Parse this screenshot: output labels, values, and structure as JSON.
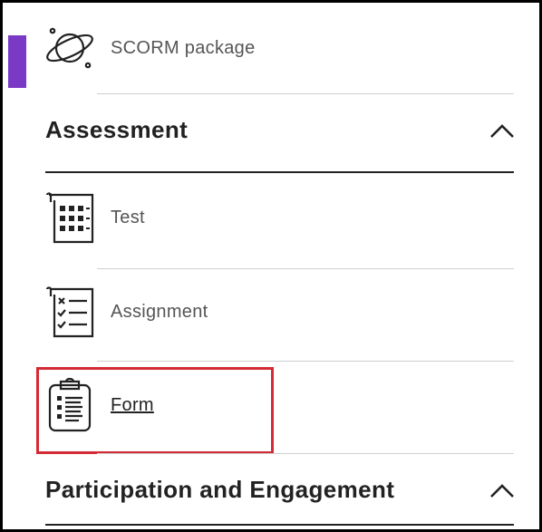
{
  "items": {
    "scorm": {
      "label": "SCORM package",
      "icon": "planet-icon"
    },
    "test": {
      "label": "Test",
      "icon": "test-grid-icon"
    },
    "assignment": {
      "label": "Assignment",
      "icon": "assignment-checklist-icon"
    },
    "form": {
      "label": "Form",
      "icon": "clipboard-form-icon"
    }
  },
  "sections": {
    "assessment": {
      "title": "Assessment",
      "icon": "chevron-up-icon",
      "expanded": true
    },
    "participation": {
      "title": "Participation and Engagement",
      "icon": "chevron-up-icon",
      "expanded": true
    }
  },
  "colors": {
    "accent_tab": "#7b3ac6",
    "highlight": "#d42a34"
  }
}
